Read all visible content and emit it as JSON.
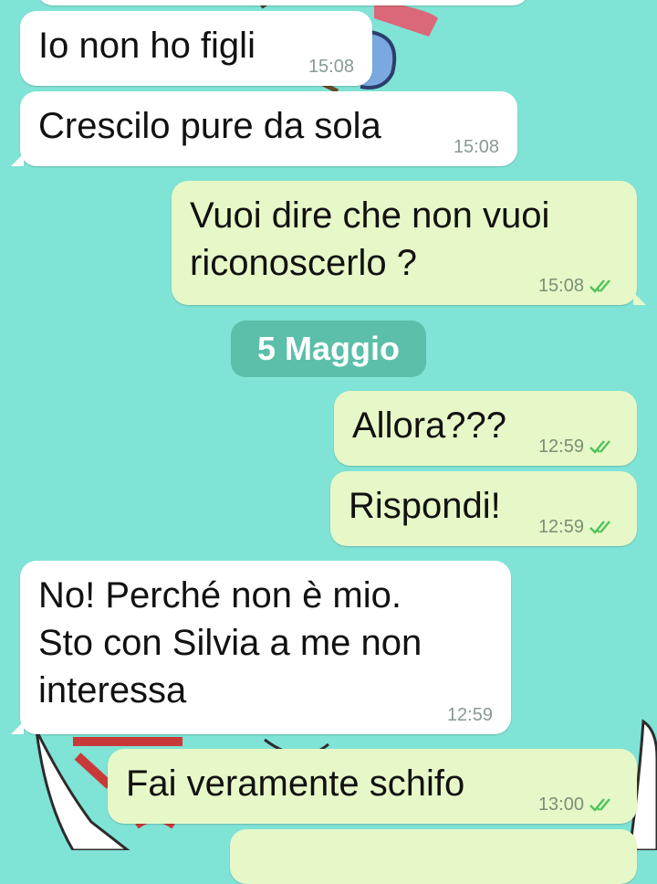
{
  "wallpaper": {
    "name": "cartoon-wallpaper",
    "primary_color": "#7fe3d6"
  },
  "chat": {
    "date_separator": "5 Maggio",
    "messages": [
      {
        "dir": "in",
        "text": "Io non ho figli",
        "time": "15:08"
      },
      {
        "dir": "in",
        "text": "Crescilo pure da sola",
        "time": "15:08"
      },
      {
        "dir": "out",
        "text": "Vuoi dire che non vuoi\nriconoscerlo ?",
        "time": "15:08",
        "status": "read"
      },
      {
        "dir": "out",
        "text": "Allora???",
        "time": "12:59",
        "status": "read"
      },
      {
        "dir": "out",
        "text": "Rispondi!",
        "time": "12:59",
        "status": "read"
      },
      {
        "dir": "in",
        "text": "No! Perché non è mio.\nSto con Silvia a me non\ninteressa",
        "time": "12:59"
      },
      {
        "dir": "out",
        "text": "Fai veramente schifo",
        "time": "13:00",
        "status": "read"
      }
    ]
  },
  "colors": {
    "incoming_bubble": "#ffffff",
    "outgoing_bubble": "#e6f8c8",
    "date_chip": "#5bbfa9",
    "read_ticks": "#4fc35a"
  }
}
